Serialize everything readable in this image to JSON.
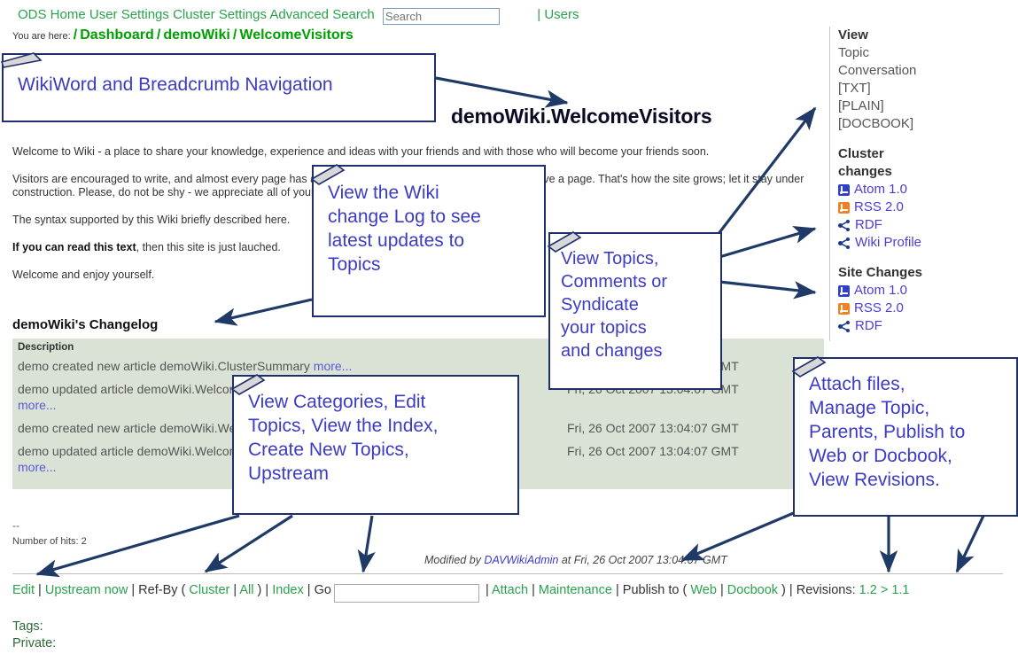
{
  "topnav": {
    "items": [
      "ODS Home",
      "User Settings",
      "Cluster Settings",
      "Advanced Search"
    ],
    "search_placeholder": "Search",
    "search_value": "",
    "users_label": "| Users"
  },
  "breadcrumb": {
    "prefix": "You are here:",
    "items": [
      "Dashboard",
      "demoWiki",
      "WelcomeVisitors"
    ]
  },
  "page": {
    "title": "demoWiki.WelcomeVisitors",
    "paragraphs": [
      "Welcome to Wiki - a place to share your knowledge, experience and ideas with your friends and with those who will become your friends soon.",
      "Visitors are encouraged to write, and almost every page has an Edit button - just press it if you want to improve a page. That's how the site grows; let it stay under construction. Please, do not be shy - we appreciate all of your ideas.",
      "The syntax supported by this Wiki briefly described here.",
      "If you can read this text, then this site is just lauched.",
      "Welcome and enjoy yourself."
    ],
    "syntax_link": "here",
    "bold_lead": "If you can read this text",
    "dashes": "--",
    "hits": "Number of hits: 2"
  },
  "sidebar": {
    "view": {
      "heading": "View",
      "items": [
        "Topic",
        "Conversation",
        "[TXT]",
        "[PLAIN]",
        "[DOCBOOK]"
      ]
    },
    "cluster_changes": {
      "heading": "Cluster changes",
      "feeds": [
        {
          "label": "Atom 1.0",
          "icon": "atom-feed-icon"
        },
        {
          "label": "RSS 2.0",
          "icon": "rss-feed-icon"
        },
        {
          "label": "RDF",
          "icon": "rdf-icon"
        },
        {
          "label": "Wiki Profile",
          "icon": "rdf-icon"
        }
      ]
    },
    "site_changes": {
      "heading": "Site Changes",
      "feeds": [
        {
          "label": "Atom 1.0",
          "icon": "atom-feed-icon"
        },
        {
          "label": "RSS 2.0",
          "icon": "rss-feed-icon"
        },
        {
          "label": "RDF",
          "icon": "rdf-icon"
        }
      ]
    }
  },
  "changelog": {
    "title": "demoWiki's Changelog",
    "header_description": "Description",
    "rows": [
      {
        "description": "demo created new article demoWiki.ClusterSummary",
        "more": "more...",
        "date": "Fri, 26 Oct 2007 13:04:07 GMT"
      },
      {
        "description": "demo updated article demoWiki.WelcomeVisitors (1.2).",
        "more": "more...",
        "date": "Fri, 26 Oct 2007 13:04:07 GMT"
      },
      {
        "description": "demo created new article demoWiki.WelcomeVisitors",
        "more": "",
        "date": "Fri, 26 Oct 2007 13:04:07 GMT"
      },
      {
        "description": "demo updated article demoWiki.WelcomeVisitors (1.2).",
        "more": "more...",
        "date": "Fri, 26 Oct 2007 13:04:07 GMT"
      }
    ]
  },
  "modified": {
    "prefix": "Modified by",
    "user": "DAVWikiAdmin",
    "suffix": "at Fri, 26 Oct 2007 13:04:07 GMT"
  },
  "footer": {
    "edit": "Edit",
    "upstream_now": "Upstream now",
    "ref_by": "Ref-By",
    "cluster": "Cluster",
    "all": "All",
    "index": "Index",
    "go": "Go",
    "go_value": "",
    "attach": "Attach",
    "maintenance": "Maintenance",
    "publish_to": "Publish to",
    "web": "Web",
    "docbook": "Docbook",
    "revisions_label": "Revisions:",
    "revisions_value": "1.2 > 1.1",
    "tags": "Tags:",
    "private": "Private:"
  },
  "callouts": [
    {
      "id": "wikiword-breadcrumb",
      "text": "WikiWord and Breadcrumb Navigation"
    },
    {
      "id": "change-log",
      "text": "View the Wiki\nchange Log to see\nlatest updates to\nTopics"
    },
    {
      "id": "view-topics-syndicate",
      "text": "View Topics,\nComments or\nSyndicate\nyour topics\nand changes"
    },
    {
      "id": "categories-index",
      "text": "View Categories, Edit\nTopics, View the Index,\nCreate New Topics,\nUpstream"
    },
    {
      "id": "attach-manage",
      "text": "Attach files,\nManage Topic,\nParents, Publish to\nWeb or Docbook,\nView Revisions."
    }
  ],
  "colors": {
    "link_green": "#2aa14c",
    "breadcrumb_green": "#00a000",
    "callout_text": "#3b3bc4",
    "callout_border": "#1f2f6e",
    "arrow": "#1f3a66",
    "table_bg": "#d9e2d5",
    "atom_icon": "#2f3fd0",
    "rss_icon": "#f08020"
  }
}
